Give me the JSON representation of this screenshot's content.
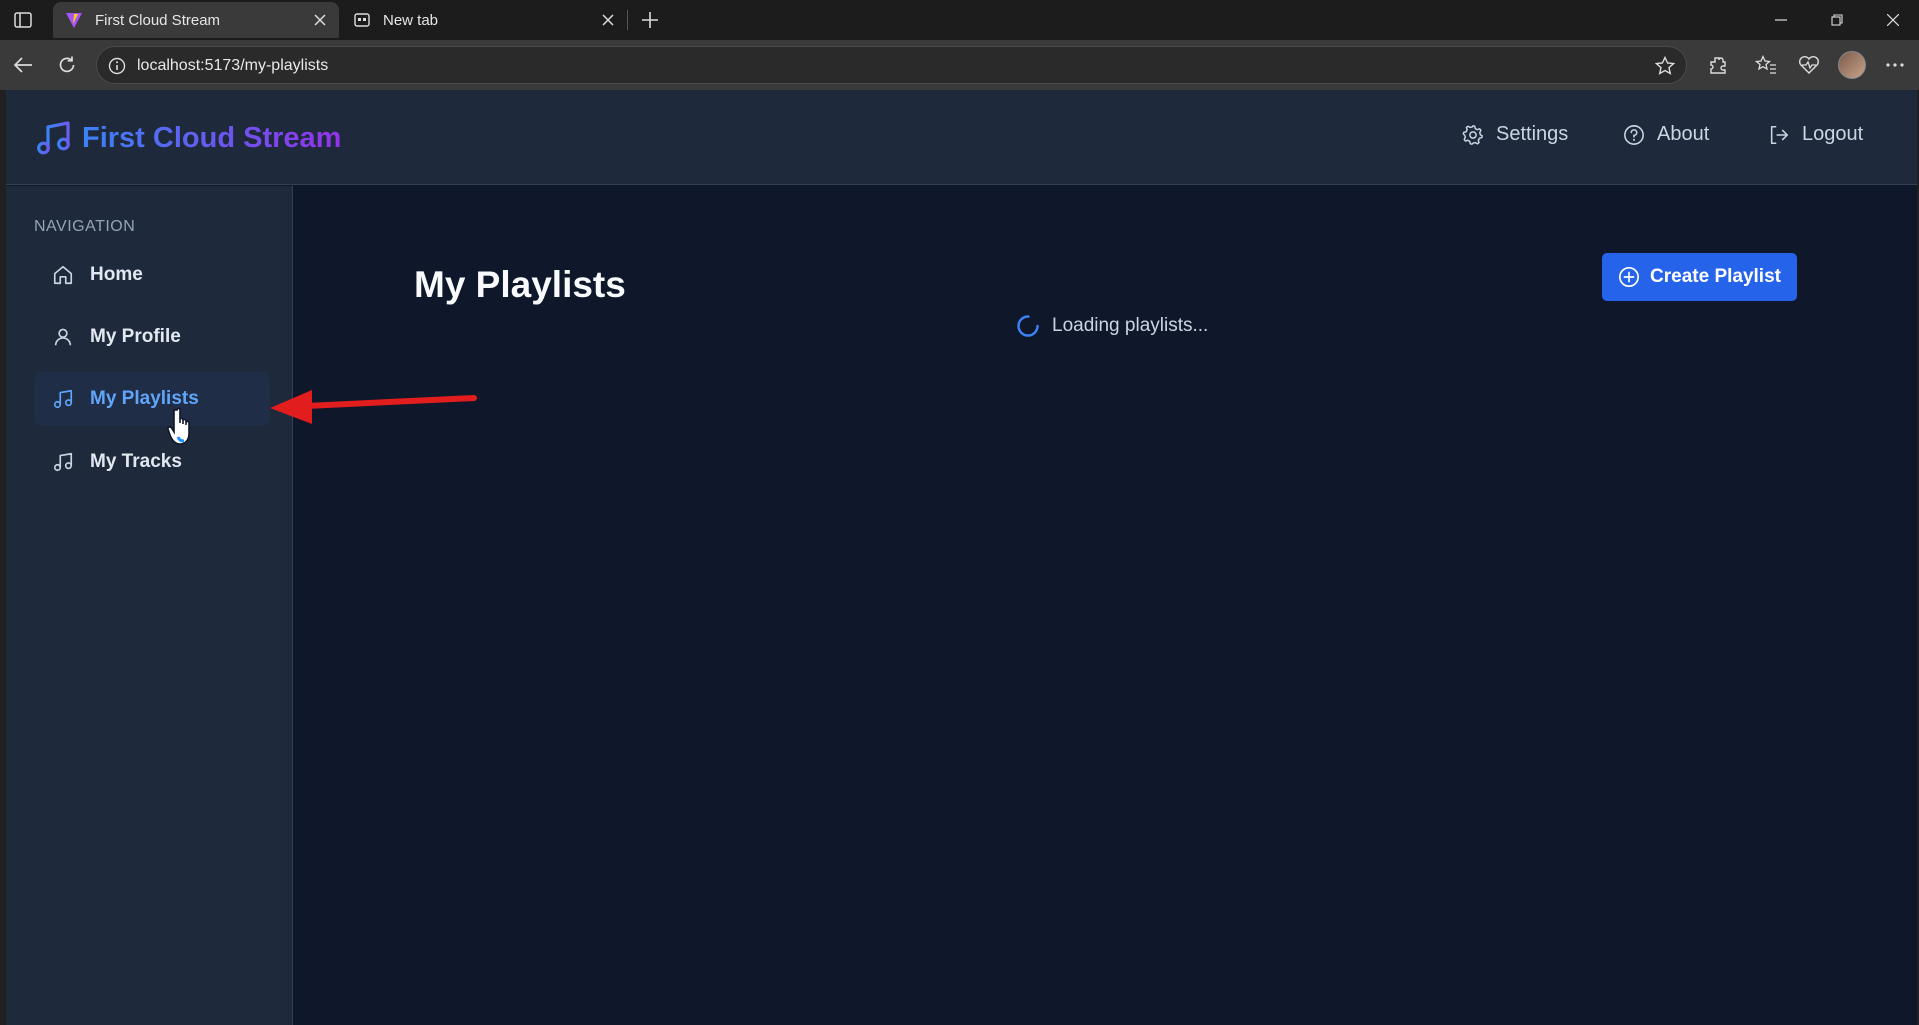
{
  "browser": {
    "tabs": [
      {
        "title": "First Cloud Stream",
        "active": true
      },
      {
        "title": "New tab",
        "active": false
      }
    ],
    "url": "localhost:5173/my-playlists"
  },
  "app": {
    "brand": "First Cloud Stream",
    "header_links": {
      "settings": "Settings",
      "about": "About",
      "logout": "Logout"
    },
    "sidebar": {
      "heading": "NAVIGATION",
      "items": [
        {
          "label": "Home",
          "icon": "home-icon",
          "active": false
        },
        {
          "label": "My Profile",
          "icon": "user-icon",
          "active": false
        },
        {
          "label": "My Playlists",
          "icon": "music-note-icon",
          "active": true
        },
        {
          "label": "My Tracks",
          "icon": "music-note-icon",
          "active": false
        }
      ]
    },
    "main": {
      "title": "My Playlists",
      "create_button": "Create Playlist",
      "loading_text": "Loading playlists..."
    }
  },
  "colors": {
    "background": "#0f172a",
    "panel": "#1e293b",
    "accent": "#2563eb",
    "active_text": "#60a5fa",
    "annotation_arrow": "#e11d1d"
  }
}
